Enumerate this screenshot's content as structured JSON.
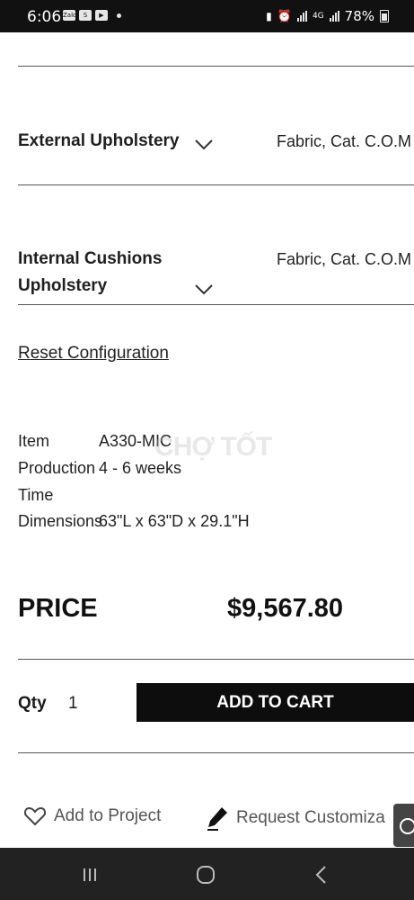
{
  "status_bar": {
    "time": "6:06",
    "left_icons": [
      "zalo-icon",
      "shopee-icon",
      "youtube-icon",
      "dot-icon"
    ],
    "right_icons": [
      "sim-icon",
      "alarm-icon",
      "signal-icon",
      "4g-icon",
      "signal-icon"
    ],
    "network": "4G",
    "battery": "78%"
  },
  "options": [
    {
      "label": "External Upholstery",
      "value": "Fabric, Cat. C.O.M"
    },
    {
      "label_line1": "Internal Cushions",
      "label_line2": "Upholstery",
      "value": "Fabric, Cat. C.O.M"
    }
  ],
  "reset_label": "Reset Configuration",
  "specs": {
    "item_label": "Item",
    "item_value": "A330-MIC",
    "production_label_line1": "Production",
    "production_label_line2": "Time",
    "production_value": "4 - 6 weeks",
    "dimensions_label": "Dimensions",
    "dimensions_value": "63\"L x 63\"D x 29.1\"H"
  },
  "price": {
    "label": "PRICE",
    "value": "$9,567.80"
  },
  "qty": {
    "label": "Qty",
    "value": "1"
  },
  "add_to_cart": "ADD TO CART",
  "actions": {
    "add_to_project": "Add to Project",
    "request_customization": "Request Customiza"
  },
  "watermark": "CHỢ TỐT",
  "colors": {
    "button_bg": "#0d0d0d",
    "button_text": "#ffffff",
    "nav_bg": "#222222",
    "status_bg": "#111111"
  }
}
